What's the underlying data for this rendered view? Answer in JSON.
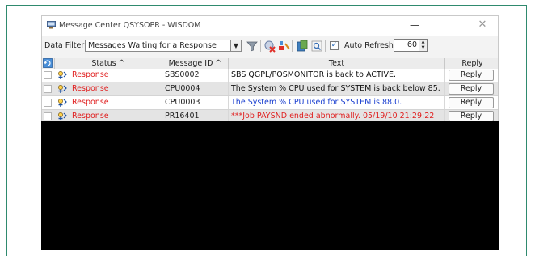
{
  "window": {
    "title": "Message Center QSYSOPR - WISDOM",
    "minimize": "—",
    "close": "✕"
  },
  "toolbar": {
    "filter_label": "Data Filter:",
    "filter_value": "Messages Waiting for a Response",
    "filter_dropdown": "▼",
    "auto_refresh_checked": true,
    "auto_refresh_check": "☑",
    "auto_refresh_label": "Auto Refresh",
    "refresh_interval": "60",
    "spin": "▲▼",
    "icons": [
      "filter-icon",
      "delete-icon",
      "clear-icon",
      "reports-icon",
      "find-icon"
    ]
  },
  "grid": {
    "columns": {
      "status": "Status ^",
      "message_id": "Message ID ^",
      "text": "Text",
      "reply": "Reply"
    },
    "rows": [
      {
        "status": "Response",
        "message_id": "SBS0002",
        "text": "SBS QGPL/POSMONITOR is back to ACTIVE.",
        "text_color": "#111111",
        "reply": "Reply"
      },
      {
        "status": "Response",
        "message_id": "CPU0004",
        "text": "The System % CPU used for SYSTEM is back below 85.",
        "text_color": "#111111",
        "reply": "Reply"
      },
      {
        "status": "Response",
        "message_id": "CPU0003",
        "text": "The System % CPU used for SYSTEM is 88.0.",
        "text_color": "#1a3fd0",
        "reply": "Reply"
      },
      {
        "status": "Response",
        "message_id": "PR16401",
        "text": "***Job PAYSND ended abnormally. 05/19/10 21:29:22",
        "text_color": "#e02020",
        "reply": "Reply"
      }
    ]
  },
  "colors": {
    "status_red": "#e02020",
    "frame_green": "#2f8a6e",
    "row_selected": "#e4e4e4"
  }
}
